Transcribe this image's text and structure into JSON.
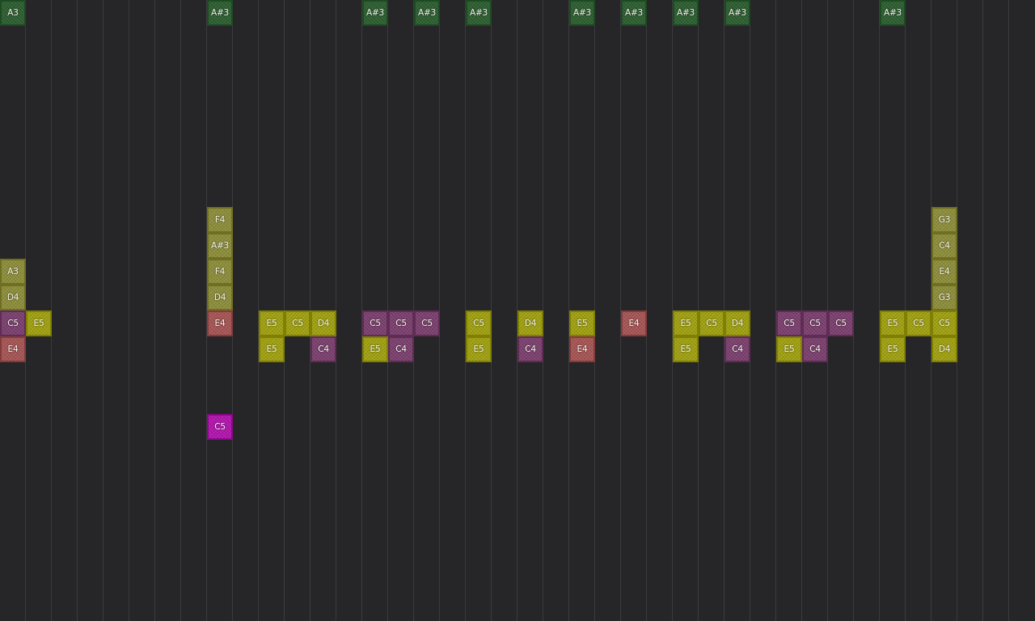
{
  "colors": {
    "green": "#2c5e30",
    "olive": "#8e8f3a",
    "yellow": "#a2a210",
    "plum": "#7c406f",
    "salmon": "#a85555",
    "magenta": "#b414b0",
    "background": "#262628",
    "grid_line": "#3b3b3e"
  },
  "notes": [
    {
      "label": "A3",
      "color": "green"
    },
    {
      "label": "A#3",
      "color": "green"
    },
    {
      "label": "A#3",
      "color": "green"
    },
    {
      "label": "A#3",
      "color": "green"
    },
    {
      "label": "A#3",
      "color": "green"
    },
    {
      "label": "A#3",
      "color": "green"
    },
    {
      "label": "A#3",
      "color": "green"
    },
    {
      "label": "A#3",
      "color": "green"
    },
    {
      "label": "A#3",
      "color": "green"
    },
    {
      "label": "A#3",
      "color": "green"
    },
    {
      "label": "F4",
      "color": "olive"
    },
    {
      "label": "G3",
      "color": "olive"
    },
    {
      "label": "A#3",
      "color": "olive"
    },
    {
      "label": "C4",
      "color": "olive"
    },
    {
      "label": "A3",
      "color": "olive"
    },
    {
      "label": "F4",
      "color": "olive"
    },
    {
      "label": "E4",
      "color": "olive"
    },
    {
      "label": "D4",
      "color": "olive"
    },
    {
      "label": "D4",
      "color": "olive"
    },
    {
      "label": "G3",
      "color": "olive"
    },
    {
      "label": "C5",
      "color": "plum"
    },
    {
      "label": "E5",
      "color": "yellow"
    },
    {
      "label": "E4",
      "color": "salmon"
    },
    {
      "label": "E5",
      "color": "yellow"
    },
    {
      "label": "C5",
      "color": "yellow"
    },
    {
      "label": "D4",
      "color": "yellow"
    },
    {
      "label": "C5",
      "color": "plum"
    },
    {
      "label": "C5",
      "color": "plum"
    },
    {
      "label": "C5",
      "color": "plum"
    },
    {
      "label": "C5",
      "color": "yellow"
    },
    {
      "label": "D4",
      "color": "yellow"
    },
    {
      "label": "E5",
      "color": "yellow"
    },
    {
      "label": "E4",
      "color": "salmon"
    },
    {
      "label": "E5",
      "color": "yellow"
    },
    {
      "label": "C5",
      "color": "yellow"
    },
    {
      "label": "D4",
      "color": "yellow"
    },
    {
      "label": "C5",
      "color": "plum"
    },
    {
      "label": "C5",
      "color": "plum"
    },
    {
      "label": "C5",
      "color": "plum"
    },
    {
      "label": "E5",
      "color": "yellow"
    },
    {
      "label": "C5",
      "color": "yellow"
    },
    {
      "label": "C5",
      "color": "yellow"
    },
    {
      "label": "E4",
      "color": "salmon"
    },
    {
      "label": "E5",
      "color": "yellow"
    },
    {
      "label": "C4",
      "color": "plum"
    },
    {
      "label": "E5",
      "color": "yellow"
    },
    {
      "label": "C4",
      "color": "plum"
    },
    {
      "label": "E5",
      "color": "yellow"
    },
    {
      "label": "C4",
      "color": "plum"
    },
    {
      "label": "E4",
      "color": "salmon"
    },
    {
      "label": "E5",
      "color": "yellow"
    },
    {
      "label": "C4",
      "color": "plum"
    },
    {
      "label": "E5",
      "color": "yellow"
    },
    {
      "label": "C4",
      "color": "plum"
    },
    {
      "label": "E5",
      "color": "yellow"
    },
    {
      "label": "D4",
      "color": "yellow"
    },
    {
      "label": "C5",
      "color": "magenta"
    }
  ]
}
